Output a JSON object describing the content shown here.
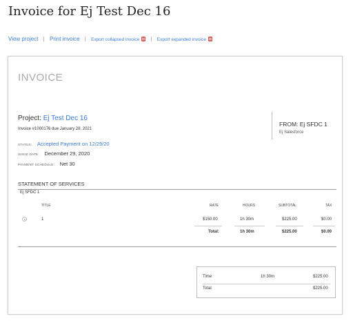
{
  "page": {
    "title": "Invoice for Ej Test Dec 16"
  },
  "actions": {
    "view_project": "View project",
    "print_invoice": "Print invoice",
    "export_collapsed": "Export collapsed invoice",
    "export_expanded": "Export expanded invoice",
    "separator": "|",
    "pdf_icon": "pdf-icon",
    "link_color": "#3a7bd5"
  },
  "invoice": {
    "heading": "INVOICE",
    "project_label": "Project:",
    "project_name": "Ej Test Dec 16",
    "invoice_line": "Invoice #1000176 due January 28, 2021",
    "status_label": "STATUS:",
    "status_value": "Accepted Payment on 12/29/20",
    "issue_date_label": "ISSUE DATE:",
    "issue_date_value": "December 29, 2020",
    "schedule_label": "PAYMENT SCHEDULE:",
    "schedule_value": "Net 30",
    "from_title": "FROM: Ej SFDC 1",
    "from_sub": "Ej Salesforce"
  },
  "services": {
    "title": "STATEMENT OF SERVICES",
    "client": "Ej SFDC 1",
    "columns": {
      "title": "TITLE",
      "rate": "RATE",
      "hours": "HOURS",
      "subtotal": "SUBTOTAL",
      "tax": "TAX"
    },
    "rows": [
      {
        "title": "1",
        "rate": "$150.00",
        "hours": "1h 30m",
        "subtotal": "$225.00",
        "tax": "$0.00"
      }
    ],
    "total": {
      "label": "Total:",
      "hours": "1h 30m",
      "subtotal": "$225.00",
      "tax": "$0.00"
    }
  },
  "summary": {
    "time_label": "Time",
    "time_hours": "1h 30m",
    "time_amount": "$225.00",
    "total_label": "Total",
    "total_amount": "$225.00"
  }
}
